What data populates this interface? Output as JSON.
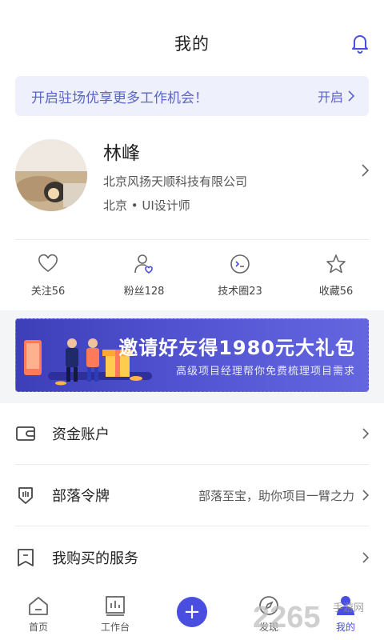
{
  "header": {
    "title": "我的",
    "icon": "bell-icon"
  },
  "promo": {
    "text": "开启驻场优享更多工作机会！",
    "action": "开启"
  },
  "profile": {
    "name": "林峰",
    "company": "北京风扬天顺科技有限公司",
    "location": "北京 • UI设计师"
  },
  "stats": [
    {
      "label": "关注56",
      "icon": "heart-icon"
    },
    {
      "label": "粉丝128",
      "icon": "fans-icon"
    },
    {
      "label": "技术圈23",
      "icon": "terminal-icon"
    },
    {
      "label": "收藏56",
      "icon": "star-icon"
    }
  ],
  "banner": {
    "title": "邀请好友得1980元大礼包",
    "subtitle": "高级项目经理帮你免费梳理项目需求"
  },
  "menu": [
    {
      "label": "资金账户",
      "right": "",
      "icon": "wallet-icon"
    },
    {
      "label": "部落令牌",
      "right": "部落至宝，助你项目一臂之力",
      "icon": "badge-icon"
    },
    {
      "label": "我购买的服务",
      "right": "",
      "icon": "bookmark-icon"
    }
  ],
  "tabs": [
    {
      "label": "首页",
      "icon": "home-icon"
    },
    {
      "label": "工作台",
      "icon": "workbench-icon"
    },
    {
      "label": "",
      "icon": "plus-icon"
    },
    {
      "label": "发现",
      "icon": "discover-icon"
    },
    {
      "label": "我的",
      "icon": "profile-icon"
    }
  ],
  "watermark": {
    "text": "2265",
    "sub": "手游网"
  },
  "colors": {
    "accent": "#4a4ee0",
    "promo_bg": "#eef0fb",
    "promo_text": "#5b64c8"
  }
}
